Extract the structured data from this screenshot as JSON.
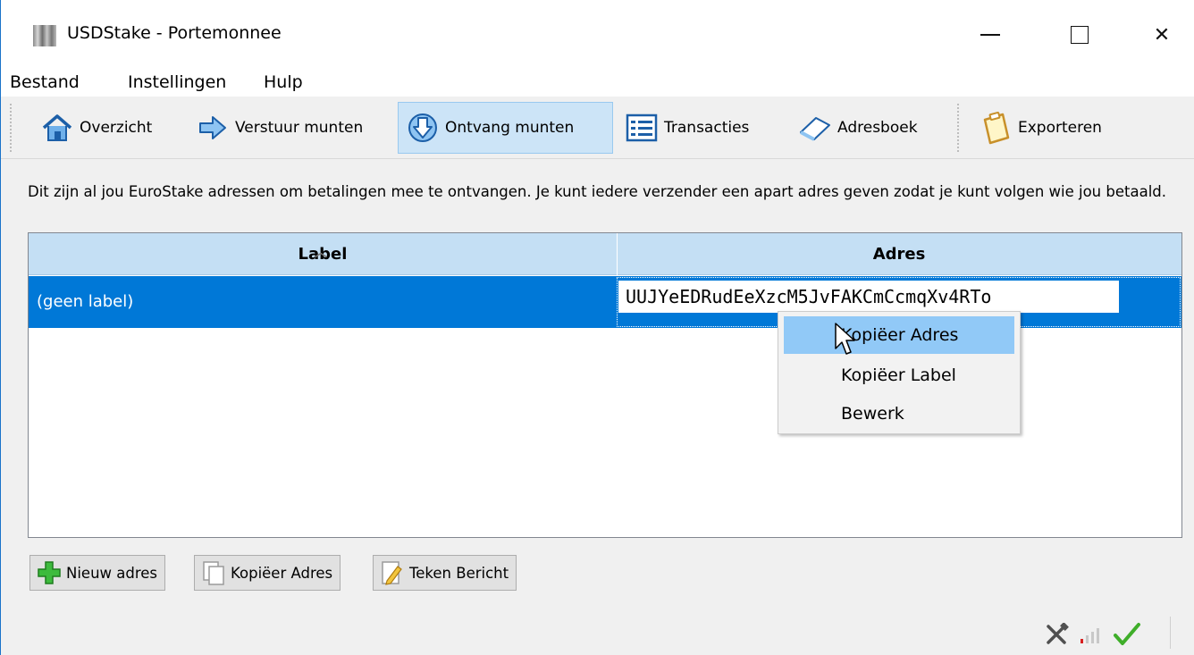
{
  "window": {
    "title": "USDStake - Portemonnee",
    "controls": {
      "minimize": "minimize",
      "maximize": "maximize",
      "close": "✕"
    }
  },
  "menubar": {
    "items": [
      "Bestand",
      "Instellingen",
      "Hulp"
    ]
  },
  "toolbar": {
    "items": [
      {
        "label": "Overzicht",
        "icon": "home-icon"
      },
      {
        "label": "Verstuur munten",
        "icon": "arrow-right-icon"
      },
      {
        "label": "Ontvang munten",
        "icon": "arrow-down-icon",
        "active": true
      },
      {
        "label": "Transacties",
        "icon": "list-icon"
      },
      {
        "label": "Adresboek",
        "icon": "address-book-icon"
      },
      {
        "label": "Exporteren",
        "icon": "clipboard-icon"
      }
    ]
  },
  "description": "Dit zijn al jou EuroStake adressen om betalingen mee te ontvangen. Je kunt iedere verzender een apart adres geven zodat je kunt volgen wie jou betaald.",
  "table": {
    "columns": [
      "Label",
      "Adres"
    ],
    "rows": [
      {
        "label": "(geen label)",
        "address": "UUJYeEDRudEeXzcM5JvFAKCmCcmqXv4RTo"
      }
    ]
  },
  "context_menu": {
    "items": [
      "Kopiëer Adres",
      "Kopiëer Label",
      "Bewerk"
    ],
    "highlighted": "Kopiëer Adres"
  },
  "buttons": {
    "new_address": "Nieuw adres",
    "copy_address": "Kopiëer Adres",
    "sign_message": "Teken Bericht"
  },
  "colors": {
    "selection": "#0078d7",
    "header": "#c4dff4",
    "menu_highlight": "#91c9f7",
    "active_tab": "#cce4f7"
  }
}
